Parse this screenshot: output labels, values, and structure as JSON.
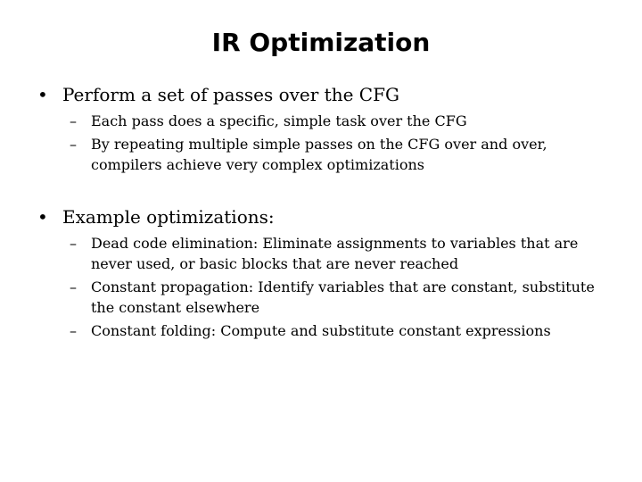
{
  "slide": {
    "title": "IR Optimization",
    "sections": [
      {
        "bullet": "•",
        "text": "Perform a set of passes over the CFG",
        "subitems": [
          {
            "dash": "–",
            "text": "Each pass does a specific, simple task over the CFG"
          },
          {
            "dash": "–",
            "text": "By repeating multiple simple passes on the CFG over and over, compilers achieve very complex optimizations"
          }
        ]
      },
      {
        "bullet": "•",
        "text": "Example optimizations:",
        "subitems": [
          {
            "dash": "–",
            "text": "Dead code elimination: Eliminate assignments to variables that are never used, or basic blocks that are never reached"
          },
          {
            "dash": "–",
            "text": "Constant propagation: Identify variables that are constant, substitute the constant elsewhere"
          },
          {
            "dash": "–",
            "text": "Constant folding: Compute and substitute constant expressions"
          }
        ]
      }
    ]
  }
}
